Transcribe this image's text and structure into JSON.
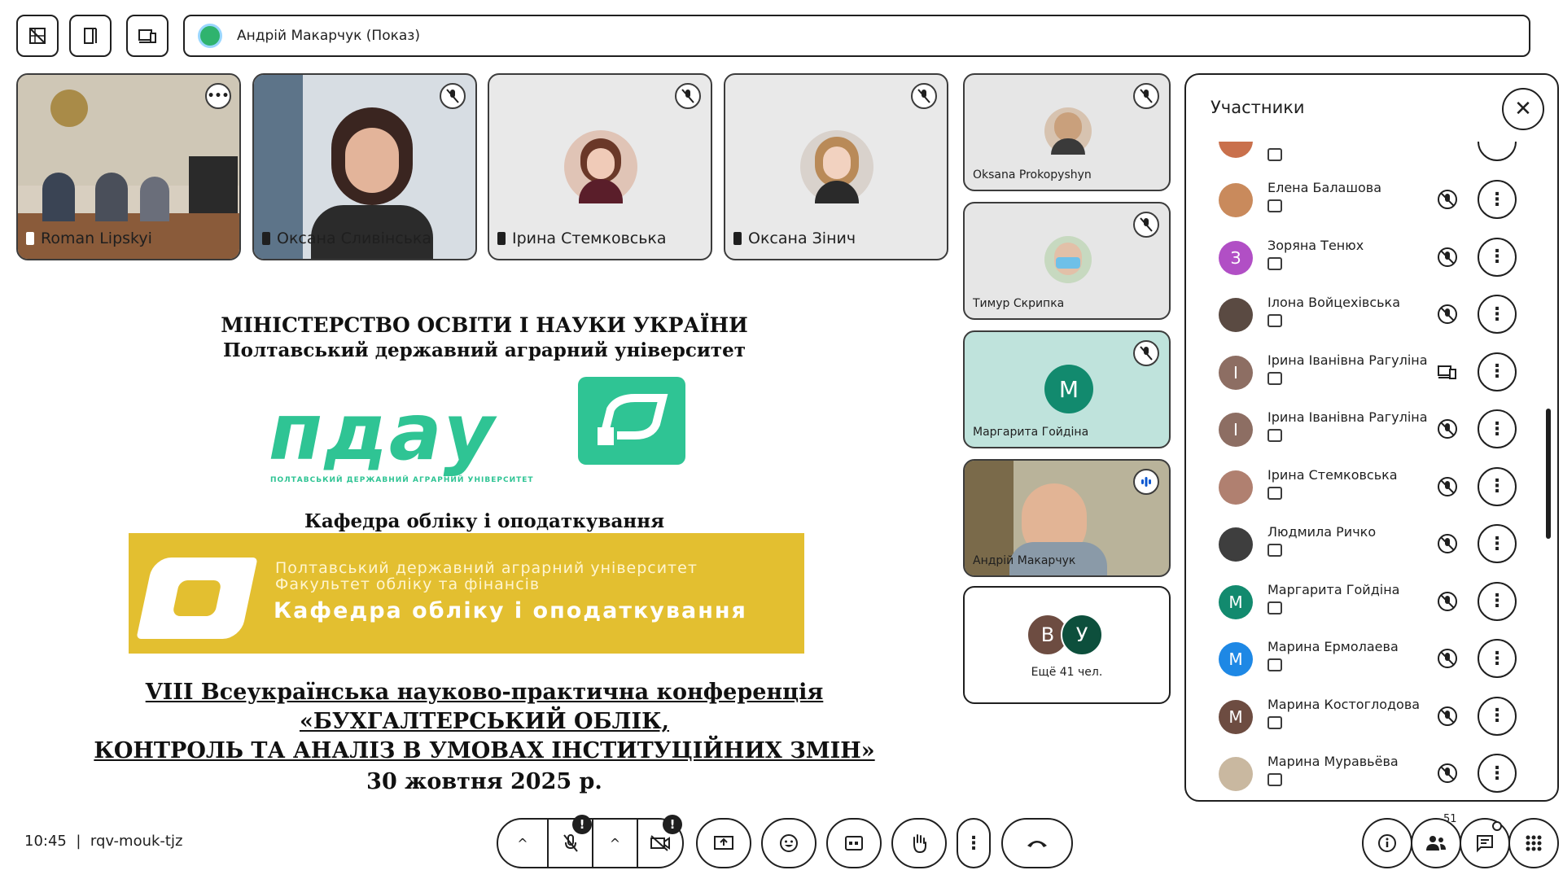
{
  "top_bar": {
    "presenter_label": "Андрій Макарчук (Показ)"
  },
  "tiles": [
    {
      "name": "Roman Lipskyi"
    },
    {
      "name": "Оксана Сливінська"
    },
    {
      "name": "Ірина Стемковська"
    },
    {
      "name": "Оксана Зінич"
    }
  ],
  "side_tiles": [
    {
      "name": "Oksana Prokopyshyn"
    },
    {
      "name": "Тимур Скрипка"
    },
    {
      "name": "Маргарита Гойдіна",
      "initial": "М"
    },
    {
      "name": "Андрій Макарчук"
    }
  ],
  "more_tile": {
    "initial_1": "В",
    "initial_2": "У",
    "label": "Ещё 41 чел."
  },
  "slide": {
    "line1": "МІНІСТЕРСТВО ОСВІТИ І НАУКИ УКРАЇНИ",
    "line2": "Полтавський державний аграрний університет",
    "logo_text": "пдау",
    "logo_sub": "ПОЛТАВСЬКИЙ ДЕРЖАВНИЙ АГРАРНИЙ УНІВЕРСИТЕТ",
    "dept": "Кафедра обліку і оподаткування",
    "banner_l1": "Полтавський державний аграрний університет",
    "banner_l2": "Факультет обліку та фінансів",
    "banner_l3": "Кафедра обліку і оподаткування",
    "conf1": "VIII Всеукраїнська науково-практична конференція",
    "conf2": "«БУХГАЛТЕРСЬКИЙ ОБЛІК,",
    "conf3": "КОНТРОЛЬ ТА АНАЛІЗ В УМОВАХ ІНСТИТУЦІЙНИХ ЗМІН»",
    "date": "30 жовтня 2025 р."
  },
  "participants_panel": {
    "title": "Участники",
    "items": [
      {
        "name": "Елена Балашова",
        "initial": "",
        "color": "#c98a5c"
      },
      {
        "name": "Зоряна Тенюх",
        "initial": "З",
        "color": "#b14fc5"
      },
      {
        "name": "Ілона Войцехівська",
        "initial": "",
        "color": "#5a4a42"
      },
      {
        "name": "Ірина Іванівна Рагуліна",
        "initial": "І",
        "color": "#8d6e63"
      },
      {
        "name": "Ірина Іванівна Рагуліна",
        "initial": "І",
        "color": "#8d6e63"
      },
      {
        "name": "Ірина Стемковська",
        "initial": "",
        "color": "#b08070"
      },
      {
        "name": "Людмила Ричко",
        "initial": "",
        "color": "#3e3e3e"
      },
      {
        "name": "Маргарита Гойдіна",
        "initial": "М",
        "color": "#128a6e"
      },
      {
        "name": "Марина Ермолаева",
        "initial": "М",
        "color": "#1e88e5"
      },
      {
        "name": "Марина Костоглодова",
        "initial": "М",
        "color": "#6d4c41"
      },
      {
        "name": "Марина Муравьёва",
        "initial": "",
        "color": "#c9b8a0"
      }
    ]
  },
  "bottom_bar": {
    "time": "10:45",
    "separator": "|",
    "meeting_code": "rqv-mouk-tjz",
    "participant_count": "51",
    "badge_mark": "!"
  },
  "colors": {
    "accent_green": "#2fc494",
    "banner_yellow": "#e3bf30"
  }
}
